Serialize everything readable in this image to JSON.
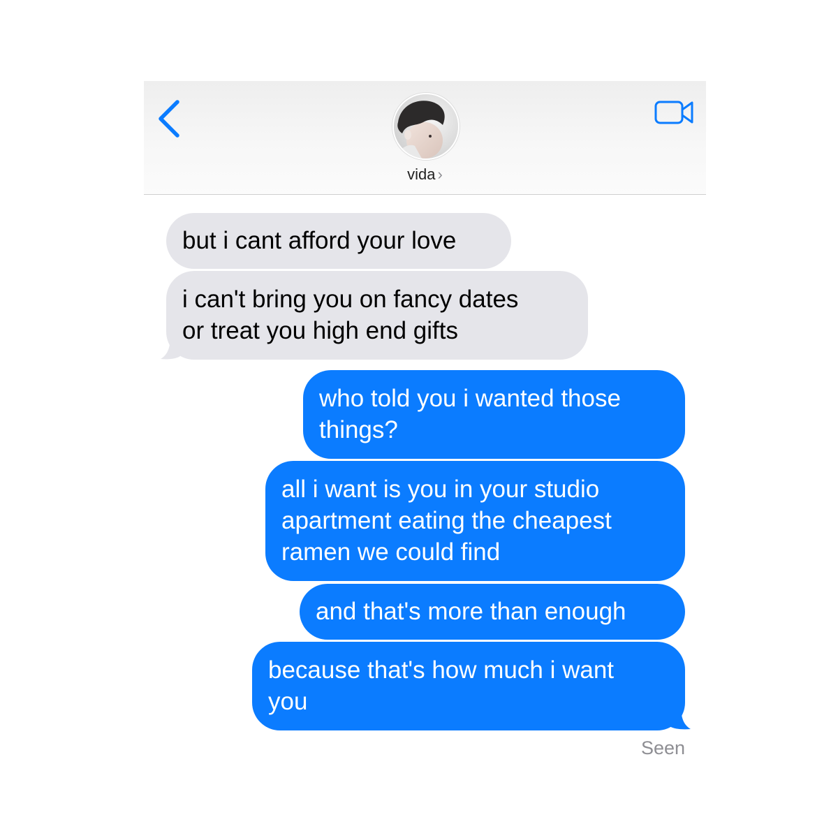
{
  "header": {
    "contact_name": "vida",
    "chevron": "›",
    "back_icon": "chevron-left-icon",
    "video_icon": "video-camera-icon"
  },
  "messages": [
    {
      "direction": "received",
      "lines": [
        "but i cant afford your love"
      ]
    },
    {
      "direction": "received",
      "lines": [
        "i can't bring you on fancy dates",
        "or treat you high end gifts"
      ]
    },
    {
      "direction": "sent",
      "lines": [
        "who told you i wanted those",
        "things?"
      ]
    },
    {
      "direction": "sent",
      "lines": [
        "all i want is you in your studio",
        "apartment eating the cheapest",
        "ramen we could find"
      ]
    },
    {
      "direction": "sent",
      "lines": [
        "and that's more than enough"
      ]
    },
    {
      "direction": "sent",
      "lines": [
        "because that's how much i want",
        "you"
      ]
    }
  ],
  "status": {
    "seen": "Seen"
  },
  "colors": {
    "accent": "#0b7cff",
    "received_bubble": "#e5e5ea",
    "header_bg": "#f2f2f2"
  }
}
